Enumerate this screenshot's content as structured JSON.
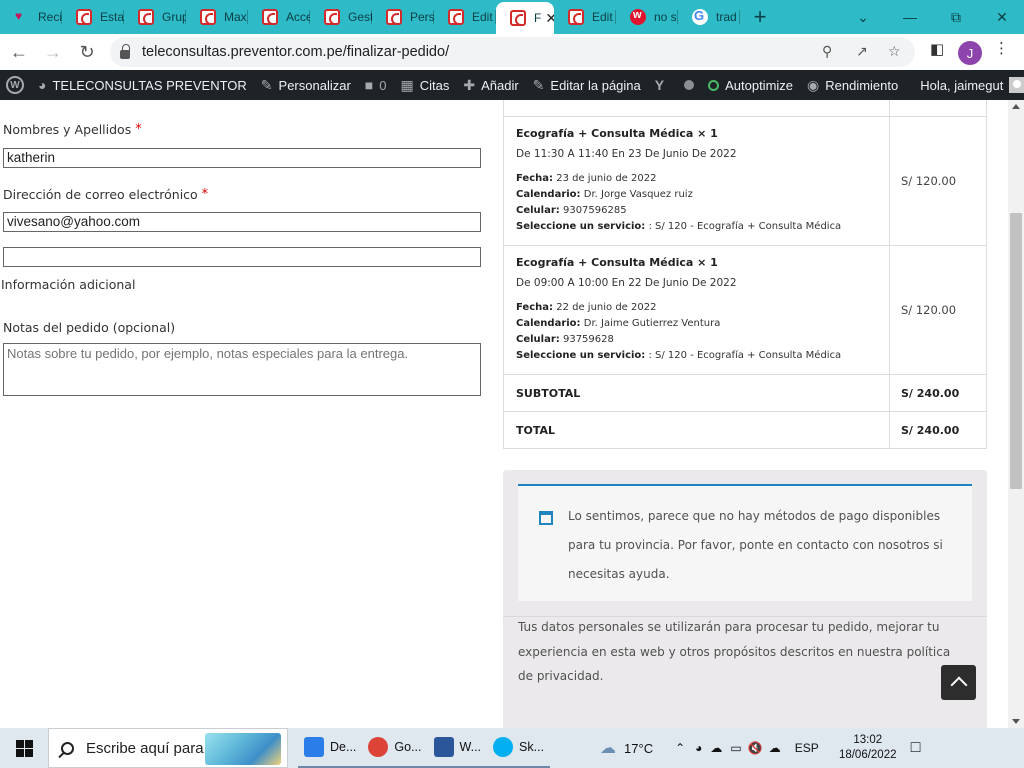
{
  "browser": {
    "tabs": [
      {
        "label": "Recit",
        "icon": "heart-icon",
        "active": false
      },
      {
        "label": "Esta",
        "icon": "preventor-icon",
        "active": false
      },
      {
        "label": "Grup",
        "icon": "preventor-icon",
        "active": false
      },
      {
        "label": "Max",
        "icon": "preventor-icon",
        "active": false
      },
      {
        "label": "Acce",
        "icon": "preventor-icon",
        "active": false
      },
      {
        "label": "Gest",
        "icon": "preventor-icon",
        "active": false
      },
      {
        "label": "Pers",
        "icon": "preventor-icon",
        "active": false
      },
      {
        "label": "Edit",
        "icon": "preventor-icon",
        "active": false
      },
      {
        "label": "F",
        "icon": "preventor-icon",
        "active": true
      },
      {
        "label": "Edit",
        "icon": "preventor-icon",
        "active": false
      },
      {
        "label": "no s",
        "icon": "wuolah-icon",
        "active": false
      },
      {
        "label": "trad",
        "icon": "google-icon",
        "active": false
      }
    ],
    "close_glyph": "✕",
    "new_tab_glyph": "+",
    "url": "teleconsultas.preventor.com.pe/finalizar-pedido/",
    "profile_initial": "J"
  },
  "wp_admin_bar": {
    "site_name": "TELECONSULTAS PREVENTOR",
    "customize": "Personalizar",
    "comments_count": "0",
    "appointments": "Citas",
    "add_new": "Añadir",
    "edit_page": "Editar la página",
    "autoptimize": "Autoptimize",
    "performance": "Rendimiento",
    "greeting": "Hola, jaimegut"
  },
  "checkout": {
    "name_label": "Nombres y Apellidos",
    "name_value": "katherin",
    "email_label": "Dirección de correo electrónico",
    "email_value": "vivesano@yahoo.com",
    "extra_value": "",
    "additional_info_title": "Información adicional",
    "notes_label": "Notas del pedido (opcional)",
    "notes_placeholder": "Notas sobre tu pedido, por ejemplo, notas especiales para la entrega.",
    "required_mark": "*"
  },
  "order": {
    "items": [
      {
        "name": "Ecografía + Consulta Médica × 1",
        "time": "De 11:30 A 11:40 En 23 De Junio De 2022",
        "fecha_label": "Fecha:",
        "fecha": "23 de junio de 2022",
        "calendario_label": "Calendario:",
        "calendario": "Dr. Jorge Vasquez ruiz",
        "celular_label": "Celular:",
        "celular": "9307596285",
        "servicio_label": "Seleccione un servicio:",
        "servicio": ": S/ 120 - Ecografía + Consulta Médica",
        "price": "S/ 120.00"
      },
      {
        "name": "Ecografía + Consulta Médica × 1",
        "time": "De 09:00 A 10:00 En 22 De Junio De 2022",
        "fecha_label": "Fecha:",
        "fecha": "22 de junio de 2022",
        "calendario_label": "Calendario:",
        "calendario": "Dr. Jaime Gutierrez Ventura",
        "celular_label": "Celular:",
        "celular": "93759628",
        "servicio_label": "Seleccione un servicio:",
        "servicio": ": S/ 120 - Ecografía + Consulta Médica",
        "price": "S/ 120.00"
      }
    ],
    "subtotal_label": "SUBTOTAL",
    "subtotal_value": "S/ 240.00",
    "total_label": "TOTAL",
    "total_value": "S/ 240.00"
  },
  "payment": {
    "notice": "Lo sentimos, parece que no hay métodos de pago disponibles para tu provincia. Por favor, ponte en contacto con nosotros si necesitas ayuda.",
    "privacy": "Tus datos personales se utilizarán para procesar tu pedido, mejorar tu experiencia en esta web y otros propósitos descritos en nuestra política de privacidad."
  },
  "taskbar": {
    "search_placeholder": "Escribe aquí para buscar",
    "apps": [
      {
        "label": "De...",
        "icon": "download-icon",
        "color": "#2b7de9"
      },
      {
        "label": "Go...",
        "icon": "chrome-icon",
        "color": "#db4437"
      },
      {
        "label": "W...",
        "icon": "word-icon",
        "color": "#2b579a"
      },
      {
        "label": "Sk...",
        "icon": "skype-icon",
        "color": "#00aff0"
      }
    ],
    "temperature": "17°C",
    "language": "ESP",
    "time": "13:02",
    "date": "18/06/2022"
  },
  "colors": {
    "tabstrip": "#2ebac6",
    "wp_bar": "#1d2327",
    "notice_accent": "#1e85be",
    "required": "#dd0000"
  }
}
